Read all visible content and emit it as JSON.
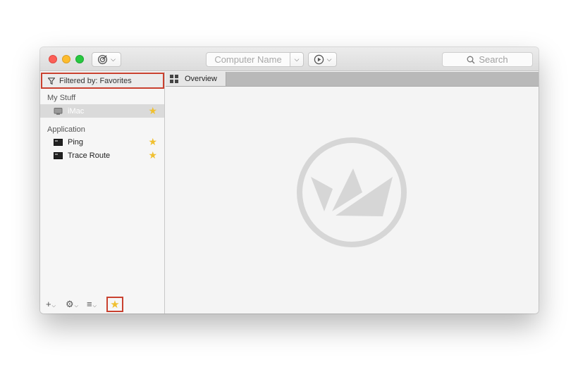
{
  "toolbar": {
    "computer_name_placeholder": "Computer Name",
    "search_placeholder": "Search"
  },
  "sidebar": {
    "filter_label": "Filtered by: Favorites",
    "sections": [
      {
        "header": "My Stuff",
        "items": [
          {
            "label": "iMac",
            "icon": "computer-icon",
            "favorite": true,
            "selected": true
          }
        ]
      },
      {
        "header": "Application",
        "items": [
          {
            "label": "Ping",
            "icon": "terminal-icon",
            "favorite": true
          },
          {
            "label": "Trace Route",
            "icon": "terminal-icon",
            "favorite": true
          }
        ]
      }
    ]
  },
  "tabs": [
    {
      "label": "Overview",
      "icon": "grid-icon",
      "active": true
    }
  ],
  "colors": {
    "highlight_border": "#c9412f",
    "favorite_star": "#f0c030",
    "close": "#fc5f57",
    "minimize": "#fdbc2e",
    "zoom": "#28c840"
  }
}
